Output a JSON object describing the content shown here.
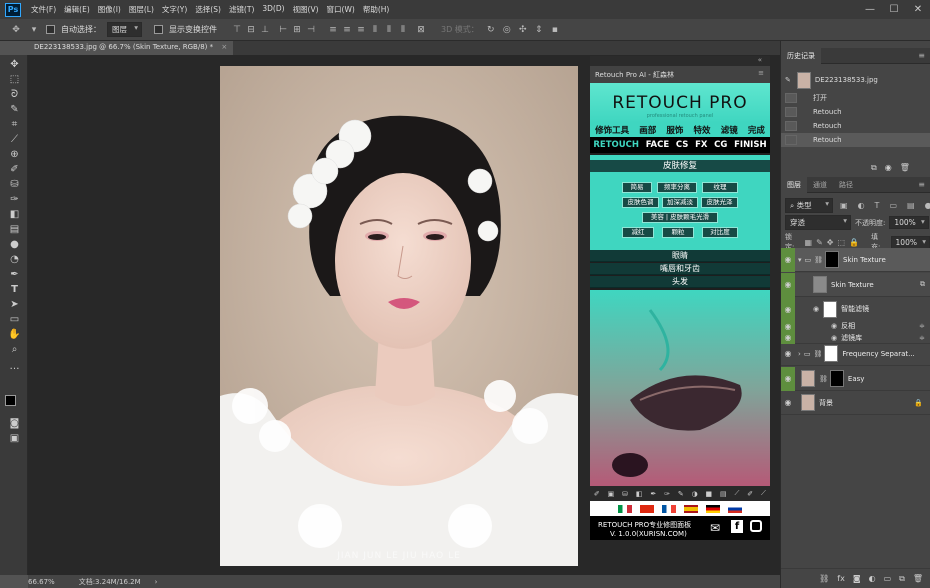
{
  "app": {
    "menu": [
      "文件(F)",
      "编辑(E)",
      "图像(I)",
      "图层(L)",
      "文字(Y)",
      "选择(S)",
      "滤镜(T)",
      "3D(D)",
      "视图(V)",
      "窗口(W)",
      "帮助(H)"
    ],
    "logo": "Ps"
  },
  "options": {
    "auto_select": "自动选择：",
    "target": "图层",
    "show_transform": "显示变换控件",
    "mode3d": "3D 模式："
  },
  "document": {
    "tab_title": "DE223138533.jpg @ 66.7% (Skin Texture, RGB/8) *",
    "watermark": "JIAN  JUN  LE  JIU  HAO  LE",
    "zoom": "66.67%",
    "doc_size": "文档:3.24M/16.2M"
  },
  "retouch_panel": {
    "title": "Retouch Pro AI - 紅森林",
    "logo": "RETOUCH PRO",
    "tagline": "professional retouch panel",
    "nav_cn": [
      "修饰工具",
      "画部",
      "服饰",
      "特效",
      "滤镜",
      "完成"
    ],
    "nav_en": [
      "RETOUCH",
      "FACE",
      "CS",
      "FX",
      "CG",
      "FINISH"
    ],
    "section_skin": "皮肤修复",
    "buttons": [
      [
        "简易",
        "频率分离",
        "纹理"
      ],
      [
        "皮肤色调",
        "加深减淡",
        "皮肤光泽"
      ],
      [
        "美容 | 皮肤颗毛光滑"
      ],
      [
        "减红",
        "颗粒",
        "对比度"
      ]
    ],
    "sub_sections": [
      "眼睛",
      "嘴唇和牙齿",
      "头发"
    ],
    "footer_line1": "RETOUCH PRO专业修图面板",
    "footer_line2": "V. 1.0.0(XURISN.COM)"
  },
  "history": {
    "tab": "历史记录",
    "snapshot": "DE223138533.jpg",
    "items": [
      "打开",
      "Retouch",
      "Retouch",
      "Retouch"
    ]
  },
  "layers": {
    "tabs": [
      "图层",
      "通道",
      "路径"
    ],
    "kind": "类型",
    "blend": "穿透",
    "opacity_label": "不透明度:",
    "opacity": "100%",
    "lock_label": "锁定:",
    "fill_label": "填充:",
    "fill": "100%",
    "items": [
      {
        "name": "Skin Texture",
        "type": "group"
      },
      {
        "name": "Skin Texture",
        "type": "smart"
      },
      {
        "name": "智能滤镜",
        "type": "filterlabel"
      },
      {
        "name": "反相",
        "type": "filter"
      },
      {
        "name": "滤镜库",
        "type": "filter"
      },
      {
        "name": "Frequency Separat...",
        "type": "group"
      },
      {
        "name": "Easy",
        "type": "layer"
      },
      {
        "name": "背景",
        "type": "bg"
      }
    ]
  },
  "colors": {
    "teal": "#3fd6c0",
    "accent": "#31a8ff",
    "green_eye": "#5e8e3e"
  }
}
